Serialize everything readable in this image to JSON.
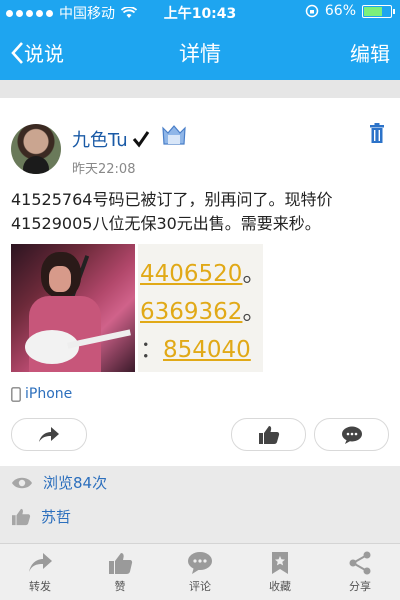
{
  "status_bar": {
    "carrier": "中国移动",
    "time": "上午10:43",
    "battery": "66%",
    "battery_level": 0.66
  },
  "nav": {
    "back_label": "说说",
    "title": "详情",
    "edit_label": "编辑"
  },
  "post": {
    "author": "九色Tu",
    "time": "昨天22:08",
    "text": "41525764号码已被订了，别再问了。现特价41529005八位无保30元出售。需要来秒。",
    "image_lines": [
      {
        "number": "4406520",
        "suffix": "。"
      },
      {
        "number": "6369362",
        "suffix": "。"
      },
      {
        "prefix": "：",
        "number": "854040"
      }
    ],
    "source": "iPhone"
  },
  "stats": {
    "views": "浏览84次",
    "likers": "苏哲"
  },
  "tabs": [
    {
      "label": "转发",
      "icon": "forward-icon"
    },
    {
      "label": "赞",
      "icon": "thumb-up-icon"
    },
    {
      "label": "评论",
      "icon": "comment-icon"
    },
    {
      "label": "收藏",
      "icon": "bookmark-icon"
    },
    {
      "label": "分享",
      "icon": "share-icon"
    }
  ],
  "colors": {
    "accent": "#1ea5f0",
    "link": "#2c6fbd",
    "number_highlight": "#e1a917"
  }
}
